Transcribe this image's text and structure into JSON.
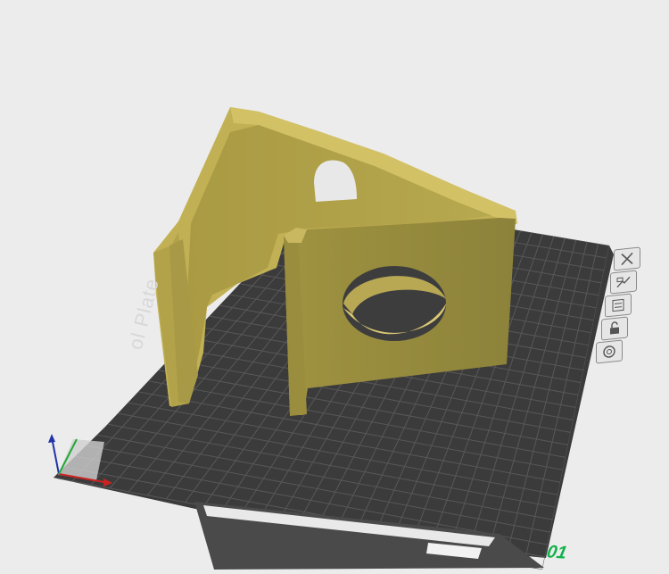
{
  "scene": {
    "background_color": "#ececec",
    "bed_color": "#3c3c3c",
    "grid_color": "#5a5a5a",
    "model_color": "#c9b35f"
  },
  "plate": {
    "label": "ol Plate",
    "number": "01",
    "number_color": "#12b24a"
  },
  "plate_tools": [
    {
      "name": "close-plate-button",
      "icon": "x-icon"
    },
    {
      "name": "arrange-plate-button",
      "icon": "arrange-icon"
    },
    {
      "name": "plate-settings-button",
      "icon": "settings-list-icon"
    },
    {
      "name": "lock-plate-button",
      "icon": "lock-icon"
    },
    {
      "name": "auto-orient-button",
      "icon": "target-icon"
    }
  ]
}
